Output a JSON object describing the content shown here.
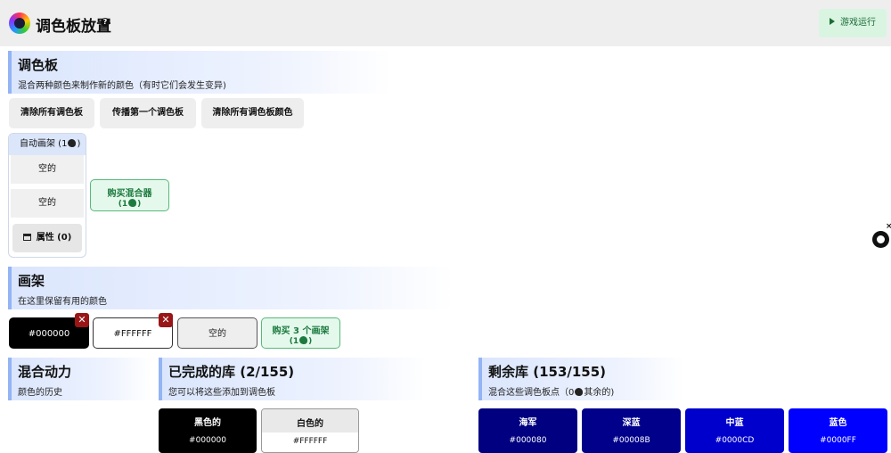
{
  "header": {
    "app_title": "调色板放置",
    "help_symbol": "?",
    "run_button_label": "游戏运行"
  },
  "palette_section": {
    "title": "调色板",
    "subtitle": "混合两种颜色来制作新的颜色（有时它们会发生变异)",
    "buttons": [
      "清除所有调色板",
      "传播第一个调色板",
      "清除所有调色板颜色"
    ]
  },
  "auto_easel": {
    "label_prefix": "自动画架 (1",
    "label_suffix": ")",
    "slots": [
      "空的",
      "空的"
    ],
    "properties_label": "属性 (0)"
  },
  "buy_mixer": {
    "label": "购买混合器",
    "cost_prefix": "(1",
    "cost_suffix": ")"
  },
  "easel_section": {
    "title": "画架",
    "subtitle": "在这里保留有用的颜色",
    "remove_symbol": "✕",
    "swatches": [
      {
        "label": "#000000",
        "color": "#000000",
        "text_color": "#ffffff"
      },
      {
        "label": "#FFFFFF",
        "color": "#ffffff",
        "text_color": "#111111"
      },
      {
        "label": "空的",
        "color": "#eeeeee",
        "text_color": "#222222"
      }
    ],
    "buy_label": "购买 3 个画架",
    "buy_cost_prefix": "(1",
    "buy_cost_suffix": ")"
  },
  "momentum_section": {
    "title": "混合动力",
    "subtitle": "颜色的历史"
  },
  "completed_section": {
    "title": "已完成的库 (2/155)",
    "subtitle": "您可以将这些添加到调色板",
    "cards": [
      {
        "name": "黑色的",
        "hex": "#000000",
        "color": "#000000",
        "text_color": "#ffffff"
      },
      {
        "name": "白色的",
        "hex": "#FFFFFF",
        "color": "#ffffff",
        "text_color": "#111111"
      }
    ]
  },
  "remaining_section": {
    "title": "剩余库 (153/155)",
    "subtitle_prefix": "混合这些调色板点（0",
    "subtitle_suffix": "其余的)",
    "cards": [
      {
        "name": "海军",
        "hex": "#000080",
        "color": "#000080"
      },
      {
        "name": "深蓝",
        "hex": "#00008B",
        "color": "#00008b"
      },
      {
        "name": "中蓝",
        "hex": "#0000CD",
        "color": "#0000cd"
      },
      {
        "name": "蓝色",
        "hex": "#0000FF",
        "color": "#0000ff"
      }
    ]
  },
  "side_widget": {
    "close_symbol": "×"
  }
}
